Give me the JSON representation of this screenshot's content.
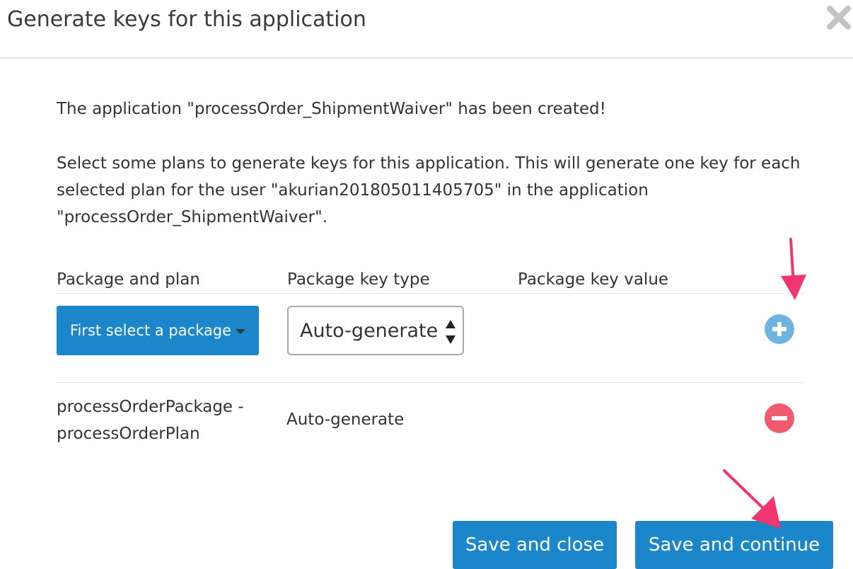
{
  "modal": {
    "title": "Generate keys for this application",
    "close_icon": "close-x-icon"
  },
  "messages": {
    "created": "The application \"processOrder_ShipmentWaiver\" has been created!",
    "instructions": "Select some plans to generate keys for this application. This will generate one key for each selected plan for the user \"akurian201805011405705\" in the application \"processOrder_ShipmentWaiver\"."
  },
  "table": {
    "headers": {
      "package_plan": "Package and plan",
      "key_type": "Package key type",
      "key_value": "Package key value"
    },
    "new_row": {
      "package_button_label": "First select a package",
      "key_type_selected": "Auto-generate",
      "add_icon": "plus-circle-icon"
    },
    "rows": [
      {
        "package_plan_line1": "processOrderPackage -",
        "package_plan_line2": "processOrderPlan",
        "key_type": "Auto-generate",
        "key_value": "",
        "remove_icon": "minus-circle-icon"
      }
    ]
  },
  "footer": {
    "save_close_label": "Save and close",
    "save_continue_label": "Save and continue"
  },
  "colors": {
    "primary": "#1b86c9",
    "add": "#6fb4e0",
    "remove": "#ef5a6f",
    "annotation_arrow": "#f0366e"
  }
}
